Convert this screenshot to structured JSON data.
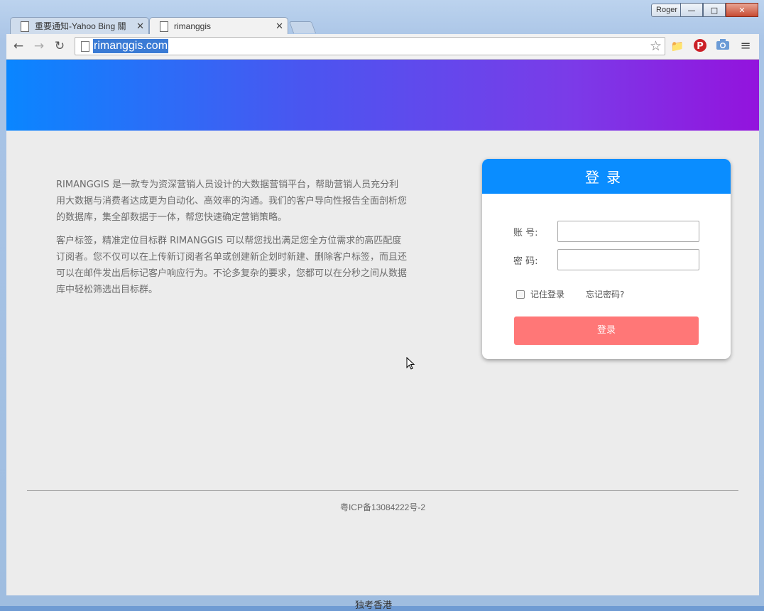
{
  "browser": {
    "profile_name": "Roger",
    "tabs": [
      {
        "title": "重要通知-Yahoo Bing 關"
      },
      {
        "title": "rimanggis"
      }
    ],
    "url": "rimanggis.com",
    "extensions": [
      "folder-icon",
      "pinterest-icon",
      "camera-icon",
      "menu-icon"
    ]
  },
  "page": {
    "intro": [
      "RIMANGGIS 是一款专为资深营销人员设计的大数据营销平台，帮助营销人员充分利用大数据与消费者达成更为自动化、高效率的沟通。我们的客户导向性报告全面剖析您的数据库，集全部数据于一体，帮您快速确定营销策略。",
      "客户标签，精准定位目标群 RIMANGGIS 可以帮您找出满足您全方位需求的高匹配度订阅者。您不仅可以在上传新订阅者名单或创建新企划时新建、删除客户标签，而且还可以在邮件发出后标记客户响应行为。不论多复杂的要求，您都可以在分秒之间从数据库中轻松筛选出目标群。"
    ],
    "login": {
      "title": "登录",
      "account_label": "账 号:",
      "password_label": "密 码:",
      "remember_label": "记住登录",
      "forgot_label": "忘记密码?",
      "submit_label": "登录"
    },
    "footer": "粤ICP备13084222号-2"
  },
  "taskbar_text": "独考香港"
}
